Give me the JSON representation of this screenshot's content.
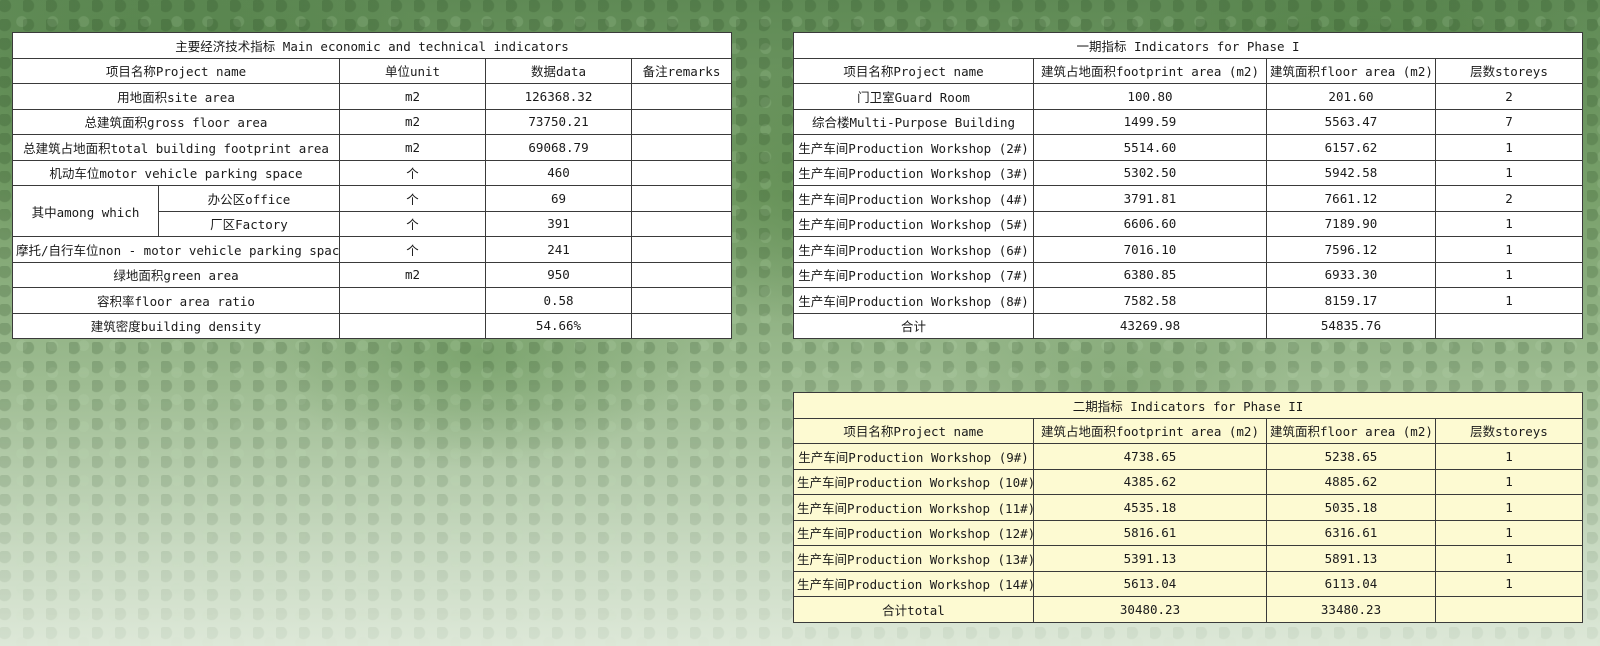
{
  "main_table": {
    "title": "主要经济技术指标 Main economic and technical indicators",
    "headers": [
      "项目名称Project name",
      "单位unit",
      "数据data",
      "备注remarks"
    ],
    "rows": [
      {
        "name": "用地面积site area",
        "unit": "m2",
        "data": "126368.32",
        "remarks": ""
      },
      {
        "name": "总建筑面积gross floor area",
        "unit": "m2",
        "data": "73750.21",
        "remarks": ""
      },
      {
        "name": "总建筑占地面积total building footprint area",
        "unit": "m2",
        "data": "69068.79",
        "remarks": ""
      },
      {
        "name": "机动车位motor vehicle parking space",
        "unit": "个",
        "data": "460",
        "remarks": ""
      }
    ],
    "among": {
      "label": "其中among which",
      "items": [
        {
          "name": "办公区office",
          "unit": "个",
          "data": "69",
          "remarks": ""
        },
        {
          "name": "厂区Factory",
          "unit": "个",
          "data": "391",
          "remarks": ""
        }
      ]
    },
    "rows_after": [
      {
        "name": "摩托/自行车位non - motor vehicle parking space",
        "unit": "个",
        "data": "241",
        "remarks": ""
      },
      {
        "name": "绿地面积green area",
        "unit": "m2",
        "data": "950",
        "remarks": ""
      },
      {
        "name": "容积率floor area ratio",
        "unit": "",
        "data": "0.58",
        "remarks": ""
      },
      {
        "name": "建筑密度building density",
        "unit": "",
        "data": "54.66%",
        "remarks": ""
      }
    ]
  },
  "phase1_table": {
    "title": "一期指标 Indicators for Phase I",
    "headers": [
      "项目名称Project name",
      "建筑占地面积footprint area (m2)",
      "建筑面积floor area (m2)",
      "层数storeys"
    ],
    "rows": [
      {
        "name": "门卫室Guard Room",
        "footprint": "100.80",
        "floor": "201.60",
        "storeys": "2"
      },
      {
        "name": "综合楼Multi-Purpose Building",
        "footprint": "1499.59",
        "floor": "5563.47",
        "storeys": "7"
      },
      {
        "name": "生产车间Production Workshop (2#)",
        "footprint": "5514.60",
        "floor": "6157.62",
        "storeys": "1"
      },
      {
        "name": "生产车间Production Workshop (3#)",
        "footprint": "5302.50",
        "floor": "5942.58",
        "storeys": "1"
      },
      {
        "name": "生产车间Production Workshop (4#)",
        "footprint": "3791.81",
        "floor": "7661.12",
        "storeys": "2"
      },
      {
        "name": "生产车间Production Workshop (5#)",
        "footprint": "6606.60",
        "floor": "7189.90",
        "storeys": "1"
      },
      {
        "name": "生产车间Production Workshop (6#)",
        "footprint": "7016.10",
        "floor": "7596.12",
        "storeys": "1"
      },
      {
        "name": "生产车间Production Workshop (7#)",
        "footprint": "6380.85",
        "floor": "6933.30",
        "storeys": "1"
      },
      {
        "name": "生产车间Production Workshop (8#)",
        "footprint": "7582.58",
        "floor": "8159.17",
        "storeys": "1"
      },
      {
        "name": "合计",
        "footprint": "43269.98",
        "floor": "54835.76",
        "storeys": ""
      }
    ]
  },
  "phase2_table": {
    "title": "二期指标 Indicators for Phase II",
    "headers": [
      "项目名称Project name",
      "建筑占地面积footprint area (m2)",
      "建筑面积floor area (m2)",
      "层数storeys"
    ],
    "rows": [
      {
        "name": "生产车间Production Workshop (9#)",
        "footprint": "4738.65",
        "floor": "5238.65",
        "storeys": "1"
      },
      {
        "name": "生产车间Production Workshop (10#)",
        "footprint": "4385.62",
        "floor": "4885.62",
        "storeys": "1"
      },
      {
        "name": "生产车间Production Workshop (11#)",
        "footprint": "4535.18",
        "floor": "5035.18",
        "storeys": "1"
      },
      {
        "name": "生产车间Production Workshop (12#)",
        "footprint": "5816.61",
        "floor": "6316.61",
        "storeys": "1"
      },
      {
        "name": "生产车间Production Workshop (13#)",
        "footprint": "5391.13",
        "floor": "5891.13",
        "storeys": "1"
      },
      {
        "name": "生产车间Production Workshop (14#)",
        "footprint": "5613.04",
        "floor": "6113.04",
        "storeys": "1"
      },
      {
        "name": "合计total",
        "footprint": "30480.23",
        "floor": "33480.23",
        "storeys": ""
      }
    ]
  }
}
